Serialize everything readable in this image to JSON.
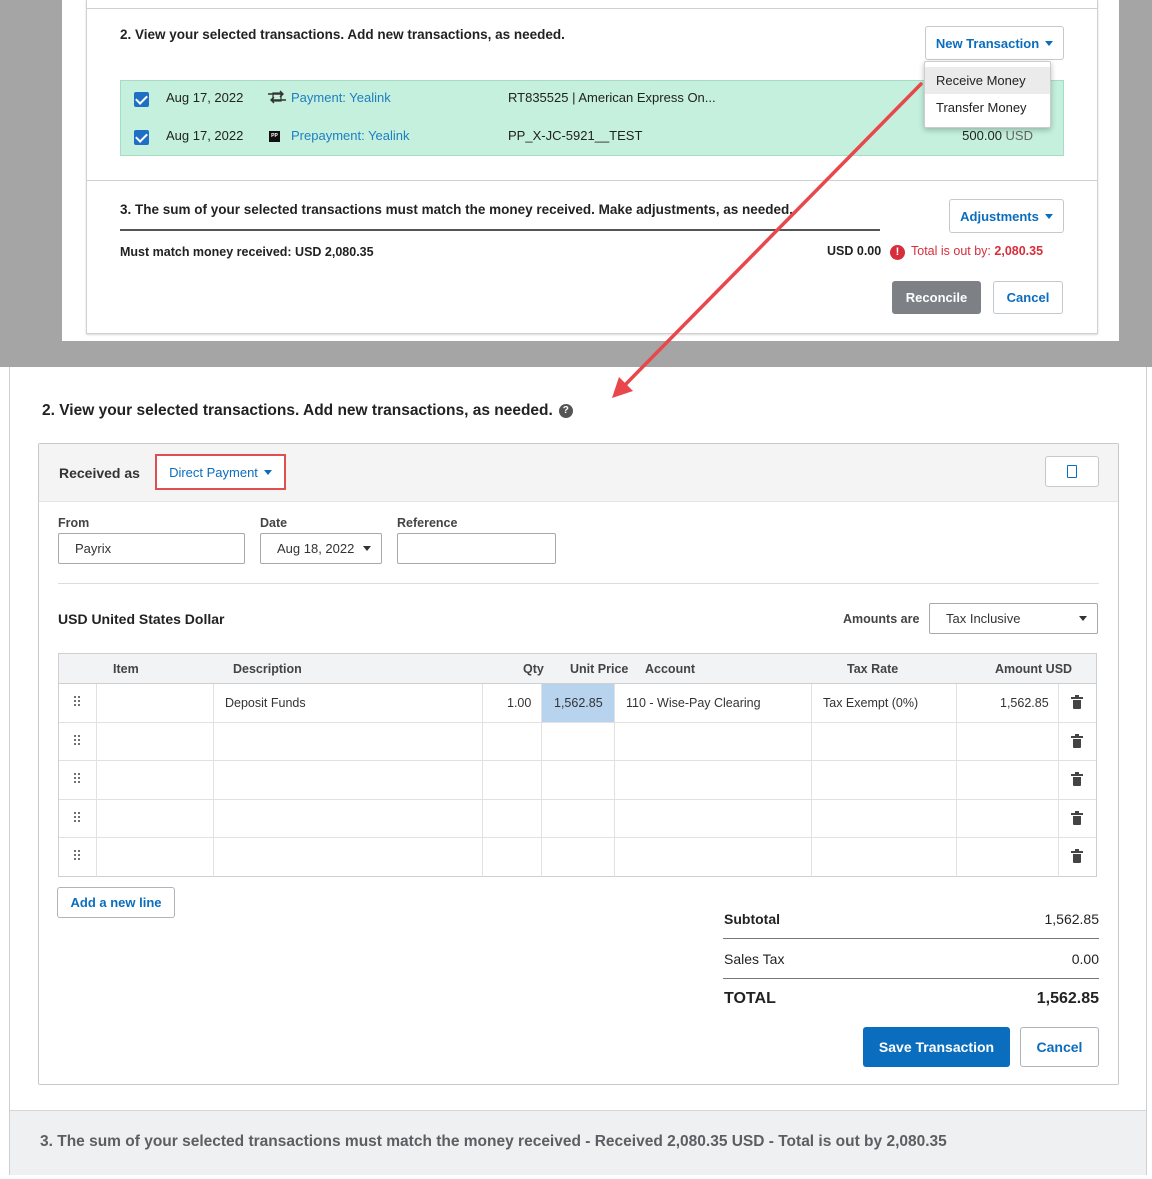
{
  "top": {
    "section2_heading": "2. View your selected transactions. Add new transactions, as needed.",
    "new_transaction_label": "New Transaction",
    "new_transaction_menu": [
      "Receive Money",
      "Transfer Money"
    ],
    "transactions": [
      {
        "date": "Aug 17, 2022",
        "type": "Payment: Yealink",
        "reference": "RT835525 | American Express On...",
        "amount": "",
        "currency": ""
      },
      {
        "date": "Aug 17, 2022",
        "type": "Prepayment: Yealink",
        "type_icon": "PP",
        "reference": "PP_X-JC-5921__TEST",
        "amount": "500.00",
        "currency": "USD"
      }
    ],
    "section3_heading": "3. The sum of your selected transactions must match the money received. Make adjustments, as needed.",
    "adjustments_label": "Adjustments",
    "must_match": "Must match money received: USD 2,080.35",
    "selected_total": "USD 0.00",
    "out_by_label": "Total is out by:",
    "out_by_value": "2,080.35",
    "reconcile_label": "Reconcile",
    "cancel_label": "Cancel"
  },
  "form": {
    "section2_heading": "2. View your selected transactions. Add new transactions, as needed.",
    "received_as_label": "Received as",
    "received_as_value": "Direct Payment",
    "from_label": "From",
    "from_value": "Payrix",
    "date_label": "Date",
    "date_value": "Aug 18, 2022",
    "reference_label": "Reference",
    "reference_value": "",
    "currency_label": "USD United States Dollar",
    "amounts_are_label": "Amounts are",
    "amounts_are_value": "Tax Inclusive",
    "columns": [
      "Item",
      "Description",
      "Qty",
      "Unit Price",
      "Account",
      "Tax Rate",
      "Amount USD"
    ],
    "lines": [
      {
        "item": "",
        "description": "Deposit Funds",
        "qty": "1.00",
        "unit_price": "1,562.85",
        "account": "110 - Wise-Pay Clearing",
        "tax_rate": "Tax Exempt (0%)",
        "amount": "1,562.85"
      },
      {
        "item": "",
        "description": "",
        "qty": "",
        "unit_price": "",
        "account": "",
        "tax_rate": "",
        "amount": ""
      },
      {
        "item": "",
        "description": "",
        "qty": "",
        "unit_price": "",
        "account": "",
        "tax_rate": "",
        "amount": ""
      },
      {
        "item": "",
        "description": "",
        "qty": "",
        "unit_price": "",
        "account": "",
        "tax_rate": "",
        "amount": ""
      },
      {
        "item": "",
        "description": "",
        "qty": "",
        "unit_price": "",
        "account": "",
        "tax_rate": "",
        "amount": ""
      }
    ],
    "add_line_label": "Add a new line",
    "subtotal_label": "Subtotal",
    "subtotal_value": "1,562.85",
    "sales_tax_label": "Sales Tax",
    "sales_tax_value": "0.00",
    "total_label": "TOTAL",
    "total_value": "1,562.85",
    "save_label": "Save Transaction",
    "cancel_label": "Cancel"
  },
  "section3_bar": "3. The sum of your selected transactions must match the money received - Received 2,080.35 USD - Total is out by 2,080.35",
  "colors": {
    "accent_blue": "#0b6dbd",
    "link_blue": "#1f7ec1",
    "selected_row_green": "#c4f0dd",
    "error_red": "#d62e3b",
    "highlight_box_red": "#e04f4f",
    "annotation_arrow": "#e8474b",
    "unit_price_highlight": "#b8d3ee"
  },
  "icons": [
    "transfer-arrows-icon",
    "prepayment-icon",
    "help-icon",
    "error-icon",
    "copy-icon",
    "drag-handle-icon",
    "trash-icon",
    "caret-down-icon"
  ]
}
